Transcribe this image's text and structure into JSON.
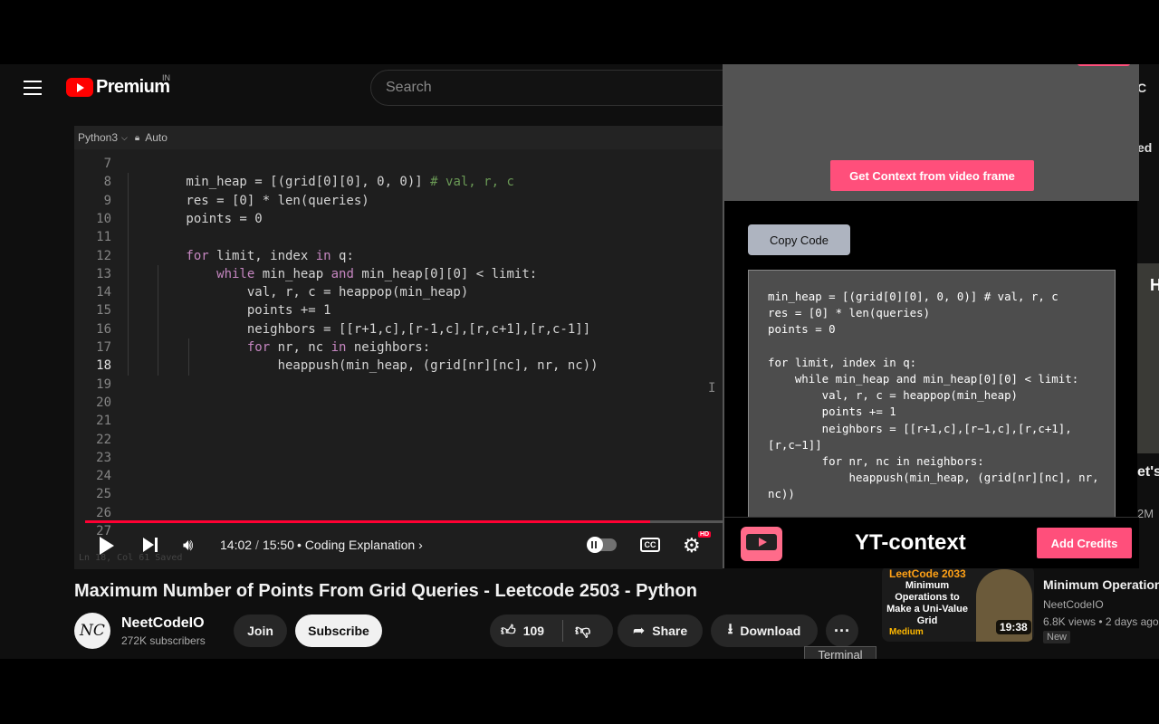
{
  "header": {
    "logo_text": "Premium",
    "region": "IN",
    "search_placeholder": "Search",
    "right_fragment": "C",
    "right_fragment2": "ed"
  },
  "editor": {
    "language": "Python3",
    "mode": "Auto",
    "status": "Ln 18, Col 61   Saved"
  },
  "code_lines": [
    {
      "n": "7",
      "t": ""
    },
    {
      "n": "8",
      "t": "        min_heap = [(grid[0][0], 0, 0)] ",
      "c": "# val, r, c"
    },
    {
      "n": "9",
      "t": "        res = [0] * len(queries)"
    },
    {
      "n": "10",
      "t": "        points = 0"
    },
    {
      "n": "11",
      "t": ""
    },
    {
      "n": "12",
      "k1": "        for",
      "t2": " limit, index ",
      "k2": "in",
      "t3": " q:"
    },
    {
      "n": "13",
      "k1": "            while",
      "t2": " min_heap ",
      "k2": "and",
      "t3": " min_heap[0][0] < limit:"
    },
    {
      "n": "14",
      "t": "                val, r, c = heappop(min_heap)"
    },
    {
      "n": "15",
      "t": "                points += 1"
    },
    {
      "n": "16",
      "t": "                neighbors = [[r+1,c],[r-1,c],[r,c+1],[r,c-1]]"
    },
    {
      "n": "17",
      "k1": "                for",
      "t2": " nr, nc ",
      "k2": "in",
      "t3": " neighbors:"
    },
    {
      "n": "18",
      "t": "                    heappush(min_heap, (grid[nr][nc], nr, nc))"
    },
    {
      "n": "19",
      "t": ""
    },
    {
      "n": "20",
      "t": ""
    },
    {
      "n": "21",
      "t": ""
    },
    {
      "n": "22",
      "t": ""
    },
    {
      "n": "23",
      "t": ""
    },
    {
      "n": "24",
      "t": ""
    },
    {
      "n": "25",
      "t": ""
    },
    {
      "n": "26",
      "t": ""
    },
    {
      "n": "27",
      "t": ""
    }
  ],
  "player": {
    "current_time": "14:02",
    "duration": "15:50",
    "time_sep": "/",
    "chapter": "Coding Explanation",
    "progress": 0.886,
    "hd": "HD",
    "cc": "CC"
  },
  "video": {
    "title": "Maximum Number of Points From Grid Queries - Leetcode 2503 - Python",
    "channel": "NeetCodeIO",
    "avatar_text": "NC",
    "subscribers": "272K subscribers",
    "join_label": "Join",
    "subscribe_label": "Subscribe",
    "likes": "109",
    "share_label": "Share",
    "download_label": "Download",
    "more_label": "···"
  },
  "tooltip": "Terminal",
  "suggestion": {
    "thumb_brand": "LeetCode 2033",
    "thumb_lines": "Minimum Operations to Make a Uni-Value Grid",
    "thumb_level": "Medium",
    "duration": "19:38",
    "title": "Minimum Operations... Uni-Value Grid - Leet",
    "channel": "NeetCodeIO",
    "meta": "6.8K views  •  2 days ago",
    "badge": "New",
    "side_text": "et's Does",
    "side_views": "2M",
    "side_letter": "H"
  },
  "extension": {
    "get_context_label": "Get Context from video frame",
    "copy_code_label": "Copy Code",
    "code": "min_heap = [(grid[0][0], 0, 0)] # val, r, c\nres = [0] * len(queries)\npoints = 0\n\nfor limit, index in q:\n    while min_heap and min_heap[0][0] < limit:\n        val, r, c = heappop(min_heap)\n        points += 1\n        neighbors = [[r+1,c],[r−1,c],[r,c+1],\n[r,c−1]]\n        for nr, nc in neighbors:\n            heappush(min_heap, (grid[nr][nc], nr,\nnc))",
    "name": "YT-context",
    "add_credits_label": "Add Credits"
  }
}
